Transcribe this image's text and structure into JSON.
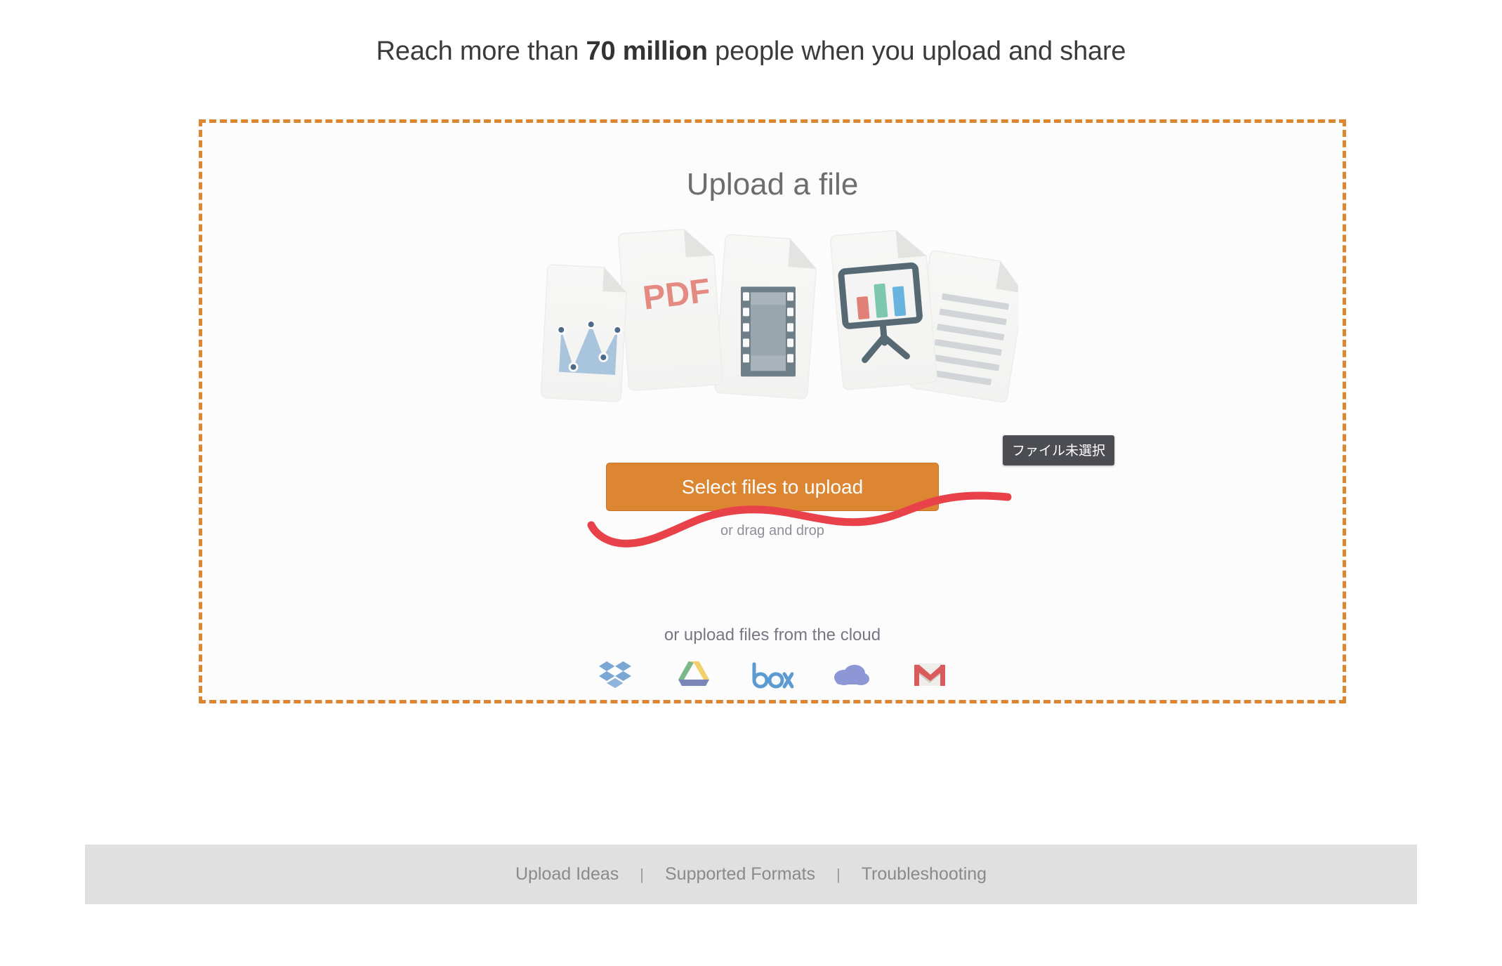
{
  "headline": {
    "prefix": "Reach more than ",
    "emphasis": "70 million",
    "suffix": " people when you upload and share"
  },
  "dropzone": {
    "title": "Upload a file",
    "select_button_label": "Select files to upload",
    "drag_text": "or drag and drop",
    "cloud_text": "or upload files from the cloud",
    "border_color": "#dd8631",
    "background": "#fcfcfc"
  },
  "tooltip": {
    "text": "ファイル未選択",
    "background": "#4b4d52",
    "color": "#ffffff"
  },
  "annotation": {
    "type": "red-scribble-underline",
    "color": "#e8414a"
  },
  "cloud_services": [
    {
      "name": "dropbox",
      "label": "Dropbox",
      "color": "#7aa7d4"
    },
    {
      "name": "google-drive",
      "label": "Google Drive",
      "colors": [
        "#7bb98a",
        "#f2d06b",
        "#7a86b8"
      ]
    },
    {
      "name": "box",
      "label": "box",
      "color": "#5b9bd1"
    },
    {
      "name": "onedrive",
      "label": "OneDrive",
      "color": "#8e97d6"
    },
    {
      "name": "gmail",
      "label": "Gmail",
      "color": "#d95b5b"
    }
  ],
  "illustration": {
    "documents": [
      {
        "type": "chart",
        "label": "area chart document",
        "color": "#a9c4dd"
      },
      {
        "type": "pdf",
        "label": "PDF",
        "color": "#e38a82"
      },
      {
        "type": "film",
        "label": "film strip document",
        "color": "#6f7f88"
      },
      {
        "type": "presentation",
        "label": "presentation document",
        "bar_colors": [
          "#e08178",
          "#7cc7ad",
          "#68b4de"
        ]
      },
      {
        "type": "text",
        "label": "text document",
        "color": "#d2d5d8"
      }
    ]
  },
  "footer": {
    "links": [
      {
        "label": "Upload Ideas"
      },
      {
        "label": "Supported Formats"
      },
      {
        "label": "Troubleshooting"
      }
    ],
    "separator": "|",
    "background": "#e0e0e0"
  }
}
